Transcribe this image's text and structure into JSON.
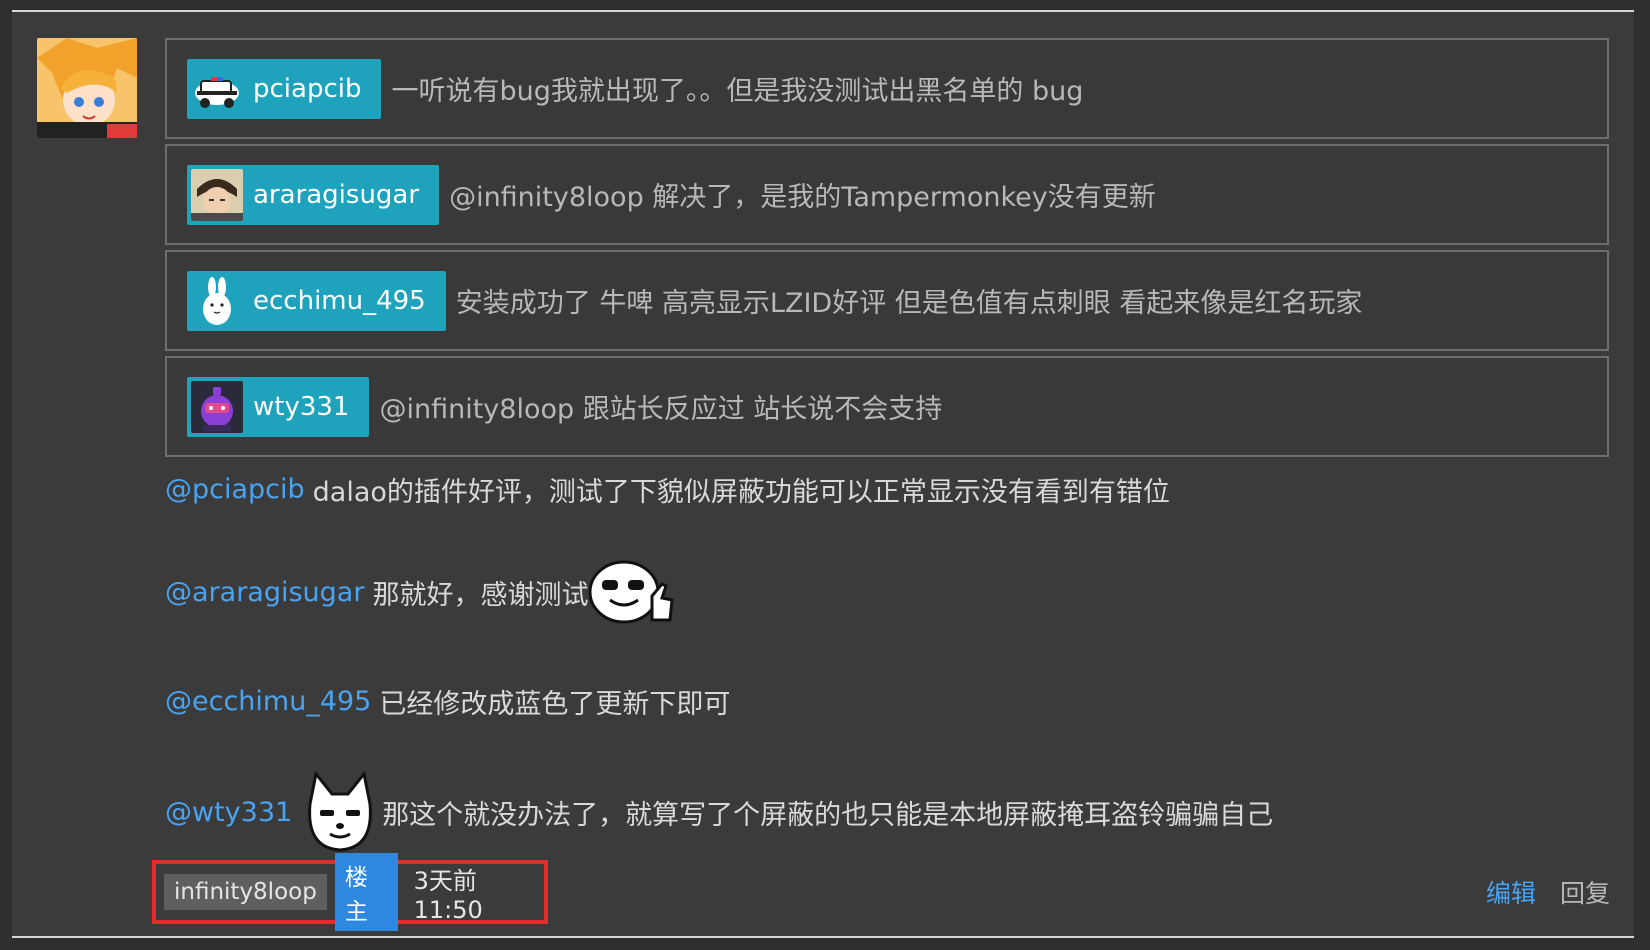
{
  "thread": {
    "avatar_icon": "anime-girl-avatar",
    "quotes": [
      {
        "username": "pciapcib",
        "avatar_icon": "police-car-avatar",
        "text": "一听说有bug我就出现了。。但是我没测试出黑名单的 bug"
      },
      {
        "username": "araragisugar",
        "avatar_icon": "anime-boy-avatar",
        "text": "@infinity8loop 解决了，是我的Tampermonkey没有更新"
      },
      {
        "username": "ecchimu_495",
        "avatar_icon": "white-rabbit-avatar",
        "text": "安装成功了 牛啤 高亮显示LZID好评 但是色值有点刺眼 看起来像是红名玩家"
      },
      {
        "username": "wty331",
        "avatar_icon": "purple-robot-avatar",
        "text": "@infinity8loop 跟站长反应过 站长说不会支持"
      }
    ],
    "replies": [
      {
        "mention": "@pciapcib",
        "text": "dalao的插件好评，测试了下貌似屏蔽功能可以正常显示没有看到有错位"
      },
      {
        "mention": "@araragisugar",
        "text": "那就好，感谢测试",
        "emoji": "thumbs-up-face-emoji"
      },
      {
        "mention": "@ecchimu_495",
        "text": "已经修改成蓝色了更新下即可"
      },
      {
        "mention": "@wty331",
        "text": "那这个就没办法了，就算写了个屏蔽的也只能是本地屏蔽掩耳盗铃骗骗自己",
        "emoji": "smug-cat-emoji"
      }
    ],
    "meta": {
      "author": "infinity8loop",
      "op_badge": "楼主",
      "time": "3天前 11:50"
    },
    "actions": {
      "edit": "编辑",
      "reply": "回复"
    },
    "colors": {
      "chip": "#1fa3bd",
      "mention": "#4aa3f0",
      "op_badge": "#2f88e0",
      "highlight_border": "#e42d2d"
    }
  }
}
